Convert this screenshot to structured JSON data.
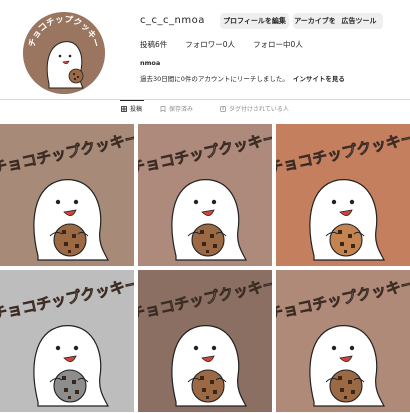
{
  "profile": {
    "username": "c_c_c_nmoa",
    "display_name": "nmoa",
    "avatar_icon": "ghost-cookie-icon",
    "avatar_color": "#9a7660"
  },
  "buttons": {
    "edit_profile": "プロフィールを編集",
    "view_archive": "アーカイブを見る",
    "ad_tools": "広告ツール"
  },
  "stats": {
    "posts": "投稿6件",
    "followers": "フォロワー0人",
    "following": "フォロー中0人"
  },
  "reach": {
    "text": "過去30日間に0件のアカウントにリーチしました。",
    "insights_link": "インサイトを見る"
  },
  "tabs": [
    {
      "label": "投稿",
      "icon": "grid-icon"
    },
    {
      "label": "保存済み",
      "icon": "bookmark-icon"
    },
    {
      "label": "タグ付けされている人",
      "icon": "tag-icon"
    }
  ],
  "posts": [
    {
      "title": "チョコチップクッキー",
      "background": "#a88a78",
      "cookie": "#9b6a45"
    },
    {
      "title": "チョコチップクッキー",
      "background": "#ad8a7c",
      "cookie": "#9b6a45"
    },
    {
      "title": "チョコチップクッキー",
      "background": "#c47f5e",
      "cookie": "#c48452"
    },
    {
      "title": "チョコチップクッキー",
      "background": "#bdbdbd",
      "cookie": "#8d8d8d"
    },
    {
      "title": "チョコチップクッキー",
      "background": "#8b6f62",
      "cookie": "#9b6a45"
    },
    {
      "title": "チョコチップクッキー",
      "background": "#b08a78",
      "cookie": "#9b6a45"
    }
  ]
}
